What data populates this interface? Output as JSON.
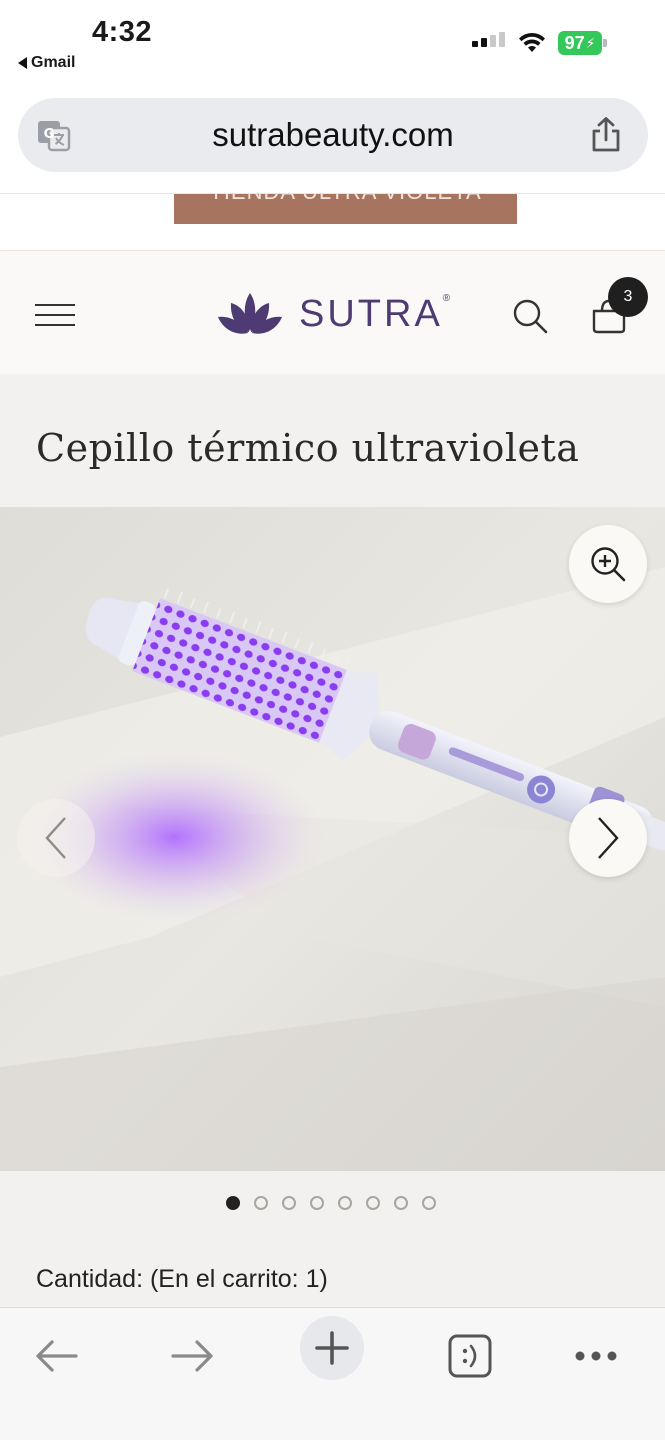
{
  "status_bar": {
    "time": "4:32",
    "back_app": "Gmail",
    "battery": "97"
  },
  "browser": {
    "url": "sutrabeauty.com"
  },
  "announcement": {
    "button_label": "TIENDA ULTRA VIOLETA"
  },
  "header": {
    "logo_text": "SUTRA",
    "logo_mark": "®",
    "cart_count": "3"
  },
  "product": {
    "title": "Cepillo térmico ultravioleta",
    "image_count": 8,
    "active_image": 1,
    "quantity_label": "Cantidad: (En el carrito: 1)"
  },
  "colors": {
    "brand_purple": "#4f3b73",
    "announce_bg": "#a7745f",
    "battery_green": "#34c759"
  },
  "icons": {
    "menu": "hamburger-icon",
    "search": "search-icon",
    "cart": "bag-icon",
    "zoom": "zoom-in-icon",
    "prev": "chevron-left-icon",
    "next": "chevron-right-icon",
    "translate": "translate-icon",
    "share": "share-icon"
  }
}
